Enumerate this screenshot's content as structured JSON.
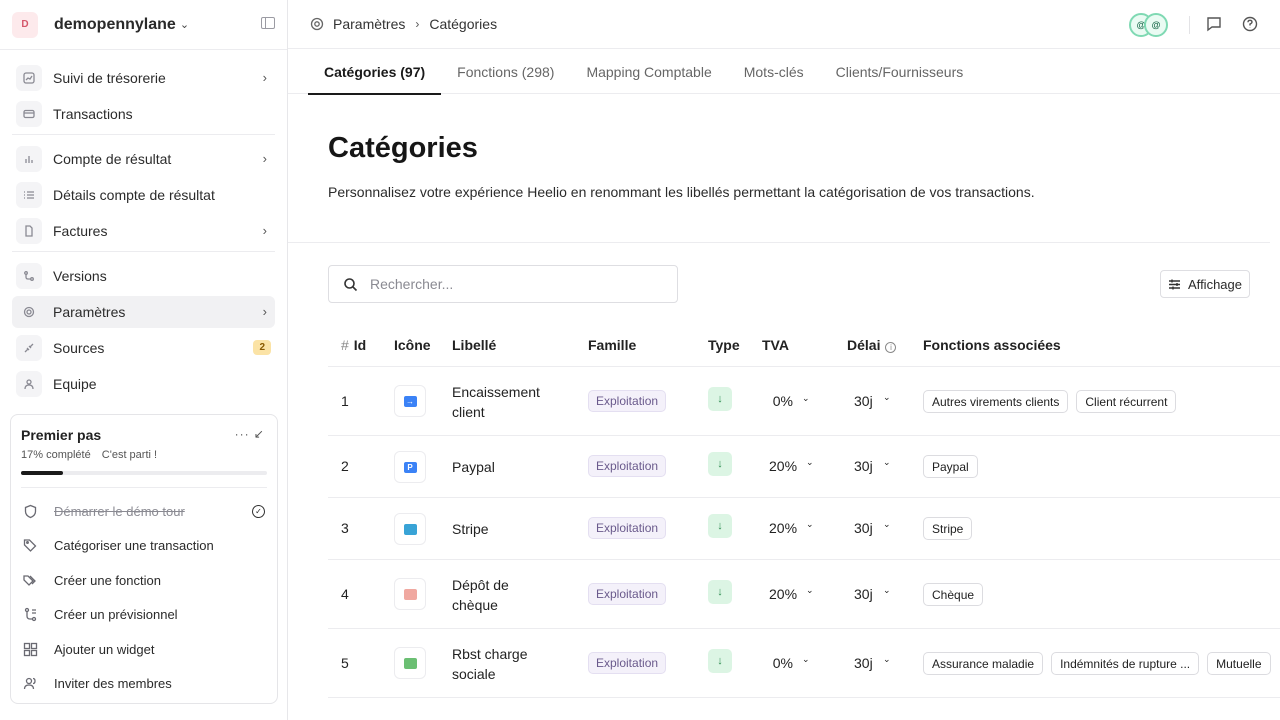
{
  "workspace": {
    "avatar": "D",
    "name": "demopennylane"
  },
  "sidebar": {
    "items": [
      {
        "label": "Suivi de trésorerie",
        "icon": "chart-line-icon",
        "arrow": "›"
      },
      {
        "label": "Transactions",
        "icon": "wallet-icon"
      },
      {
        "label": "Compte de résultat",
        "icon": "bar-chart-icon",
        "arrow": "›"
      },
      {
        "label": "Détails compte de résultat",
        "icon": "list-icon"
      },
      {
        "label": "Factures",
        "icon": "document-icon",
        "arrow": "›"
      },
      {
        "label": "Versions",
        "icon": "branch-icon"
      },
      {
        "label": "Paramètres",
        "icon": "gear-icon",
        "arrow": "›"
      },
      {
        "label": "Sources",
        "icon": "plug-icon",
        "badge": "2"
      },
      {
        "label": "Equipe",
        "icon": "user-icon"
      }
    ]
  },
  "first_steps": {
    "title": "Premier pas",
    "actions": "···  ↙",
    "progress_text": "17% complété",
    "cta": "C'est parti !",
    "progress": 0.17,
    "items": [
      {
        "label": "Démarrer le démo tour",
        "done": true
      },
      {
        "label": "Catégoriser une transaction"
      },
      {
        "label": "Créer une fonction"
      },
      {
        "label": "Créer un prévisionnel"
      },
      {
        "label": "Ajouter un widget"
      },
      {
        "label": "Inviter des membres"
      }
    ]
  },
  "breadcrumb": {
    "parent": "Paramètres",
    "current": "Catégories",
    "sep": "›"
  },
  "header": {
    "avatars": [
      "@",
      "@"
    ]
  },
  "tabs": [
    {
      "label": "Catégories (97)",
      "active": true
    },
    {
      "label": "Fonctions (298)"
    },
    {
      "label": "Mapping Comptable"
    },
    {
      "label": "Mots-clés"
    },
    {
      "label": "Clients/Fournisseurs"
    }
  ],
  "page": {
    "title": "Catégories",
    "description": "Personnalisez votre expérience Heelio en renommant les libellés permettant la catégorisation de vos transactions."
  },
  "search": {
    "placeholder": "Rechercher..."
  },
  "display_button": {
    "label": "Affichage"
  },
  "table": {
    "headers": {
      "hash": "#",
      "id": "Id",
      "icon": "Icône",
      "label": "Libellé",
      "family": "Famille",
      "type": "Type",
      "tva": "TVA",
      "delay": "Délai",
      "delay_info": "i",
      "functions": "Fonctions associées"
    },
    "rows": [
      {
        "id": "1",
        "icon_glyph": "→",
        "icon_color": "#3b82f6",
        "label": "Encaissement client",
        "family": "Exploitation",
        "type": "↓",
        "tva": "0%",
        "delay": "30j",
        "functions": [
          "Autres virements clients",
          "Client récurrent"
        ]
      },
      {
        "id": "2",
        "icon_glyph": "P",
        "icon_color": "#3b82f6",
        "label": "Paypal",
        "family": "Exploitation",
        "type": "↓",
        "tva": "20%",
        "delay": "30j",
        "functions": [
          "Paypal"
        ]
      },
      {
        "id": "3",
        "icon_glyph": "",
        "icon_color": "#38a3d6",
        "label": "Stripe",
        "family": "Exploitation",
        "type": "↓",
        "tva": "20%",
        "delay": "30j",
        "functions": [
          "Stripe"
        ]
      },
      {
        "id": "4",
        "icon_glyph": "",
        "icon_color": "#f0a8a0",
        "label": "Dépôt de chèque",
        "family": "Exploitation",
        "type": "↓",
        "tva": "20%",
        "delay": "30j",
        "functions": [
          "Chèque"
        ]
      },
      {
        "id": "5",
        "icon_glyph": "",
        "icon_color": "#6bbf73",
        "label": "Rbst charge sociale",
        "family": "Exploitation",
        "type": "↓",
        "tva": "0%",
        "delay": "30j",
        "functions": [
          "Assurance maladie",
          "Indémnités de rupture ...",
          "Mutuelle"
        ]
      }
    ]
  }
}
